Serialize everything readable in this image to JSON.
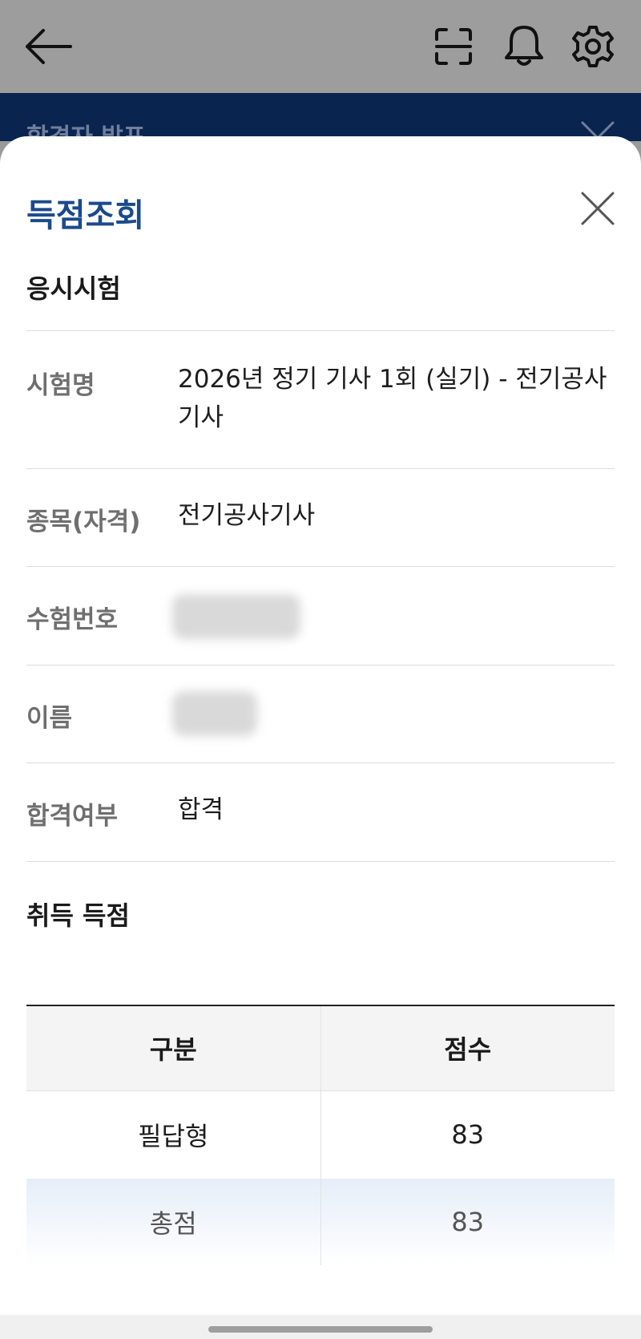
{
  "banner": {
    "title": "합격자 발표"
  },
  "sheet": {
    "title": "득점조회"
  },
  "exam_section": {
    "title": "응시시험",
    "rows": [
      {
        "label": "시험명",
        "value": "2026년 정기 기사 1회 (실기) - 전기공사기사"
      },
      {
        "label": "종목(자격)",
        "value": "전기공사기사"
      },
      {
        "label": "수험번호",
        "value": ""
      },
      {
        "label": "이름",
        "value": ""
      },
      {
        "label": "합격여부",
        "value": "합격"
      }
    ]
  },
  "score_section": {
    "title": "취득 득점",
    "headers": [
      "구분",
      "점수"
    ],
    "rows": [
      {
        "category": "필답형",
        "score": "83"
      },
      {
        "category": "총점",
        "score": "83"
      }
    ]
  },
  "icons": {
    "back": "arrow-left-icon",
    "scan": "scan-icon",
    "notifications": "bell-icon",
    "settings": "gear-icon",
    "close": "close-icon"
  },
  "colors": {
    "title_blue": "#1b4a8c",
    "banner_navy": "#0a2450",
    "total_row_bg": "#e6eef9"
  }
}
